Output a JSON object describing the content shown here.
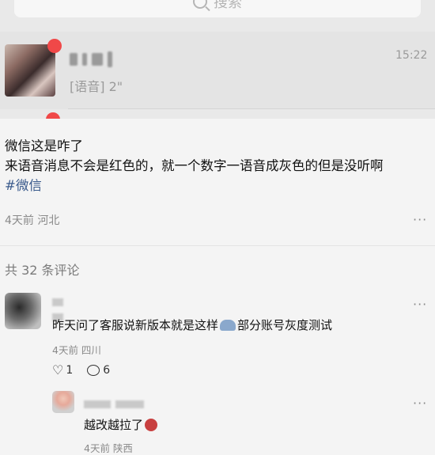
{
  "embedded_chat": {
    "search_placeholder": "搜索",
    "chat_preview": "[语音] 2\"",
    "chat_time": "15:22",
    "badge_color": "#f04848"
  },
  "post": {
    "line1": "微信这是咋了",
    "line2": "来语音消息不会是红色的，就一个数字一语音成灰色的但是没听啊",
    "tag": "#微信",
    "meta": "4天前 河北",
    "more": "···",
    "tag_color": "#3a5a8c"
  },
  "comments_count": "共 32 条评论",
  "comments": [
    {
      "text_before": "昨天问了客服说新版本就是这样",
      "text_after": "部分账号灰度测试",
      "meta": "4天前 四川",
      "likes": "1",
      "replies": "6",
      "more": "···"
    },
    {
      "text": "越改越拉了",
      "meta": "4天前 陕西",
      "more": "···"
    }
  ]
}
